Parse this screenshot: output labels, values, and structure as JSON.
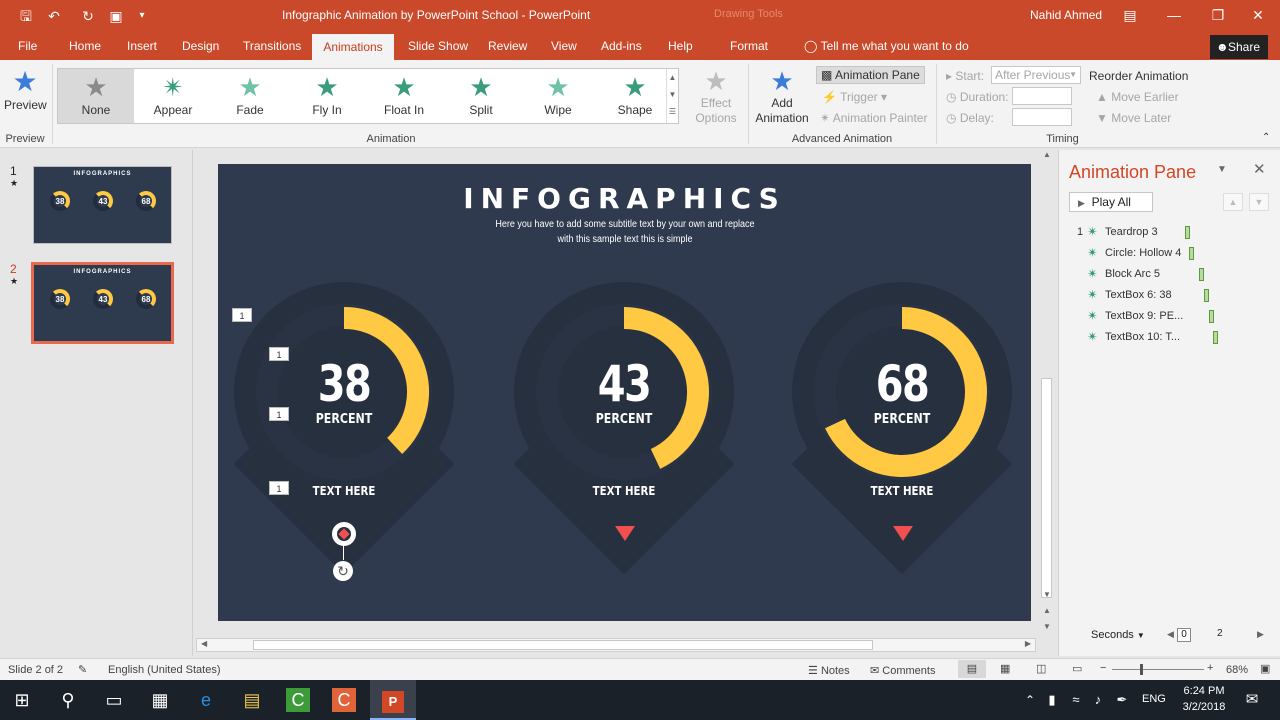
{
  "titlebar": {
    "title": "Infographic Animation by PowerPoint School  -  PowerPoint",
    "context": "Drawing Tools",
    "user": "Nahid Ahmed"
  },
  "tabs": [
    "File",
    "Home",
    "Insert",
    "Design",
    "Transitions",
    "Animations",
    "Slide Show",
    "Review",
    "View",
    "Add-ins",
    "Help",
    "Format"
  ],
  "active_tab": "Animations",
  "tell_me": "Tell me what you want to do",
  "share": "Share",
  "ribbon": {
    "preview": {
      "label": "Preview",
      "group": "Preview"
    },
    "gallery": [
      {
        "label": "None",
        "selected": true
      },
      {
        "label": "Appear"
      },
      {
        "label": "Fade"
      },
      {
        "label": "Fly In"
      },
      {
        "label": "Float In"
      },
      {
        "label": "Split"
      },
      {
        "label": "Wipe"
      },
      {
        "label": "Shape"
      }
    ],
    "effect_options": [
      "Effect",
      "Options"
    ],
    "animation_group": "Animation",
    "add_animation": [
      "Add",
      "Animation"
    ],
    "animation_pane_btn": "Animation Pane",
    "trigger": "Trigger",
    "animation_painter": "Animation Painter",
    "advanced_group": "Advanced Animation",
    "start_label": "Start:",
    "start_value": "After Previous",
    "duration_label": "Duration:",
    "delay_label": "Delay:",
    "reorder": "Reorder Animation",
    "move_earlier": "Move Earlier",
    "move_later": "Move Later",
    "timing_group": "Timing"
  },
  "thumbnails": [
    {
      "num": "1",
      "title": "INFOGRAPHICS",
      "values": [
        "38",
        "43",
        "68"
      ]
    },
    {
      "num": "2",
      "title": "INFOGRAPHICS",
      "values": [
        "38",
        "43",
        "68"
      ]
    }
  ],
  "slide": {
    "title": "INFOGRAPHICS",
    "subtitle": "Here you have to add some subtitle text by your own and replace with this sample text this is simple",
    "cards": [
      {
        "value": "38",
        "unit": "PERCENT",
        "caption": "TEXT HERE",
        "progress": 0.38
      },
      {
        "value": "43",
        "unit": "PERCENT",
        "caption": "TEXT HERE",
        "progress": 0.43
      },
      {
        "value": "68",
        "unit": "PERCENT",
        "caption": "TEXT HERE",
        "progress": 0.68
      }
    ],
    "tags": [
      "1",
      "1",
      "1",
      "1"
    ],
    "colors": {
      "background": "#2f3a4e",
      "pin": "#27303f",
      "ring": "#ffc943",
      "marker": "#f0504f"
    }
  },
  "animation_pane": {
    "title": "Animation Pane",
    "play_all": "Play All",
    "items": [
      {
        "num": "1",
        "label": "Teardrop 3"
      },
      {
        "num": "",
        "label": "Circle: Hollow 4"
      },
      {
        "num": "",
        "label": "Block Arc 5"
      },
      {
        "num": "",
        "label": "TextBox 6: 38"
      },
      {
        "num": "",
        "label": "TextBox 9: PE..."
      },
      {
        "num": "",
        "label": "TextBox 10: T..."
      }
    ],
    "seconds": "Seconds",
    "timeline": [
      "0",
      "2"
    ]
  },
  "status": {
    "slide": "Slide 2 of 2",
    "language": "English (United States)",
    "notes": "Notes",
    "comments": "Comments",
    "zoom": "68%"
  },
  "taskbar": {
    "time": "6:24 PM",
    "date": "3/2/2018",
    "lang": "ENG"
  }
}
